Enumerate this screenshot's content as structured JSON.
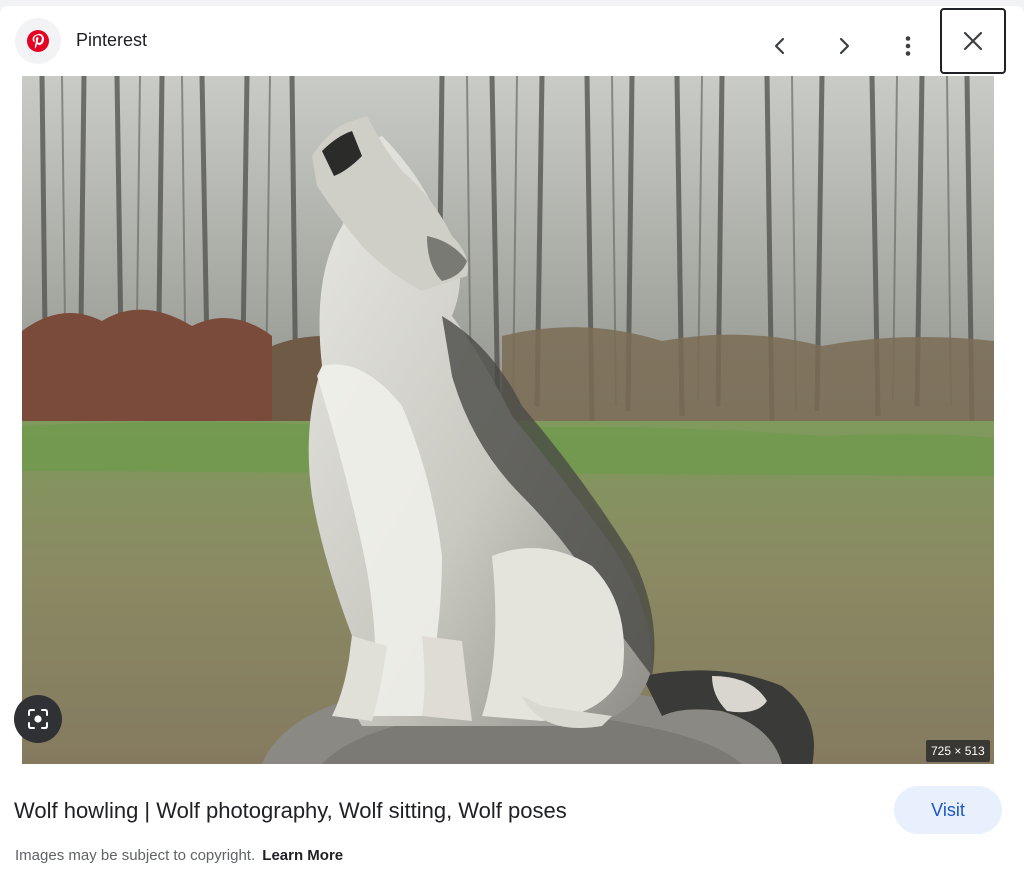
{
  "header": {
    "source_name": "Pinterest",
    "icons": {
      "source_logo": "pinterest-logo-icon",
      "prev": "chevron-left-icon",
      "next": "chevron-right-icon",
      "more": "more-vert-icon",
      "close": "close-icon"
    }
  },
  "image": {
    "dimensions": "725 × 513",
    "lens_icon": "lens-search-icon"
  },
  "footer": {
    "title": "Wolf howling | Wolf photography, Wolf sitting, Wolf poses",
    "visit_label": "Visit",
    "copyright_text": "Images may be subject to copyright.",
    "learn_more_label": "Learn More"
  },
  "colors": {
    "brand_pinterest": "#e60023",
    "visit_bg": "#e8f0fe",
    "visit_text": "#1a57c7"
  }
}
